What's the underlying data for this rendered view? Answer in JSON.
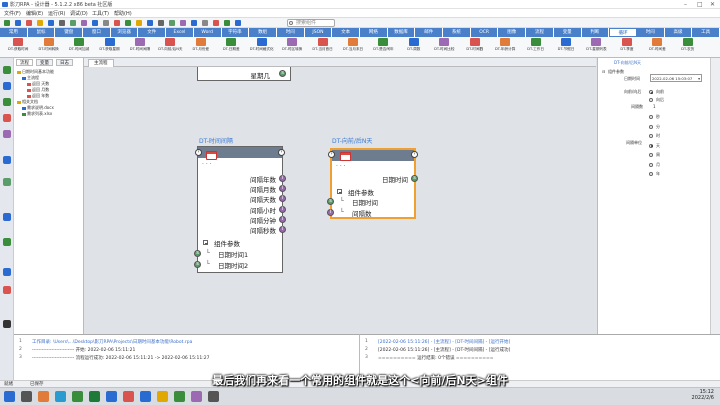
{
  "app": {
    "title": "影刀RPA - 设计器 - 5.1.2.2 x86 beta 社区版"
  },
  "menu": [
    "文件(F)",
    "编辑(E)",
    "运行(R)",
    "调试(D)",
    "工具(T)",
    "帮助(H)"
  ],
  "search": {
    "placeholder": "搜索组件"
  },
  "tabs": [
    "常用",
    "鼠标",
    "键盘",
    "窗口",
    "浏览器",
    "文件",
    "Excel",
    "Word",
    "字符串",
    "数组",
    "时间",
    "JSON",
    "文本",
    "网络",
    "数据库",
    "邮件",
    "系统",
    "OCR",
    "图像",
    "流程",
    "变量",
    "判断",
    "循环",
    "时间",
    "高级",
    "工具"
  ],
  "active_tab_index": 22,
  "tools": [
    "DT-获取时间",
    "DT-时间转换",
    "DT-时间加减",
    "DT-获取星期",
    "DT-时间间隔",
    "DT-向前/后N天",
    "DT-月份差",
    "DT-日期差",
    "DT-时间格式化",
    "DT-时区转换",
    "DT-当月首日",
    "DT-当月末日",
    "DT-是否闰年",
    "DT-周数",
    "DT-时间比较",
    "DT-时间戳",
    "DT-年龄计算",
    "DT-工作日",
    "DT-节假日",
    "DT-星期列表",
    "DT-季度",
    "DT-时间差",
    "DT-农历"
  ],
  "left_tabs": [
    "流程",
    "变量",
    "日志"
  ],
  "tree": [
    {
      "label": "日期时间基本功能",
      "level": 0
    },
    {
      "label": "主流程",
      "level": 1
    },
    {
      "label": "返回 天数",
      "level": 2
    },
    {
      "label": "返回 月数",
      "level": 2
    },
    {
      "label": "返回 年数",
      "level": 2
    },
    {
      "label": "相关文档",
      "level": 0
    },
    {
      "label": "需求说明.docx",
      "level": 1
    },
    {
      "label": "需求列表.xlsx",
      "level": 1
    }
  ],
  "doc_tab": "主流程",
  "top_node": {
    "output": "星期几"
  },
  "node_interval": {
    "title": "DT-时间间隔",
    "dots": "· · ·",
    "outputs": [
      "间隔年数",
      "间隔月数",
      "间隔天数",
      "间隔小时",
      "间隔分钟",
      "间隔秒数"
    ],
    "group": "组件参数",
    "inputs": [
      "日期时间1",
      "日期时间2"
    ]
  },
  "node_shift": {
    "title": "DT-向前/后N天",
    "dots": "· · ·",
    "outputs": [
      "日期时间"
    ],
    "group": "组件参数",
    "inputs": [
      "日期时间",
      "间隔数"
    ]
  },
  "right_panel": {
    "title": "DT-向前/后N天",
    "section": "组件参数",
    "fields": {
      "datetime_label": "日期时间",
      "datetime_value": "2022-02-06 15:03:07",
      "direction_label": "向前/向后",
      "direction_options": [
        "向前",
        "向后"
      ],
      "direction_selected": 0,
      "interval_label": "间隔数",
      "interval_value": "1",
      "unit_label": "间隔单位",
      "unit_options": [
        "秒",
        "分",
        "时",
        "天",
        "周",
        "月",
        "年"
      ],
      "unit_selected": 3
    }
  },
  "output_left": {
    "lines": [
      {
        "n": "1",
        "text": "工作目录: \\Users\\...\\Desktop\\影刀RPA\\Projects\\日期时间基本功能\\Robot.rpa"
      },
      {
        "n": "2",
        "text": "-------------------------- 开始: 2022-02-06 15:11:21"
      },
      {
        "n": "3",
        "text": "-------------------------- 流程运行成功: 2022-02-06 15:11:21 -> 2022-02-06 15:11:27"
      }
    ]
  },
  "output_right": {
    "lines": [
      {
        "n": "1",
        "text": "[2022-02-06 15:11:26] - [主流程] - [DT-时间间隔] - [运行开始]"
      },
      {
        "n": "2",
        "text": "[2022-02-06 15:11:26] - [主流程] - [DT-时间间隔] - [运行成功]"
      },
      {
        "n": "3",
        "text": "========== 运行结束: 0个错误 =========="
      }
    ]
  },
  "status": {
    "left": "就绪",
    "mid": "已保存"
  },
  "subtitle": "最后我们再来看一个常用的组件就是这个<向前/后N天>组件",
  "clock": {
    "time": "15:12",
    "date": "2022/2/6"
  },
  "colors": {
    "accent": "#4a7fc9",
    "selected_node": "#f0a030",
    "node_head": "#6d7d8f",
    "subtitle": "#ffffff"
  }
}
